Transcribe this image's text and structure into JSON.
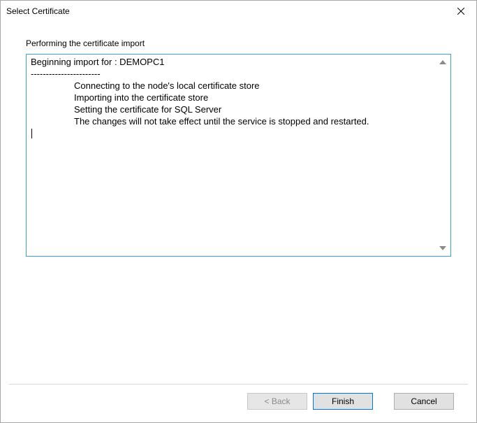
{
  "window": {
    "title": "Select Certificate"
  },
  "section": {
    "label": "Performing the certificate import"
  },
  "log": {
    "line1": "Beginning import for : DEMOPC1",
    "line2": "-----------------------",
    "line3": "Connecting to the node's local certificate store",
    "line4": "Importing into the certificate store",
    "line5": "Setting the certificate for SQL Server",
    "line6": "The changes will not take effect until the service is stopped and restarted."
  },
  "buttons": {
    "back": "< Back",
    "finish": "Finish",
    "cancel": "Cancel"
  }
}
